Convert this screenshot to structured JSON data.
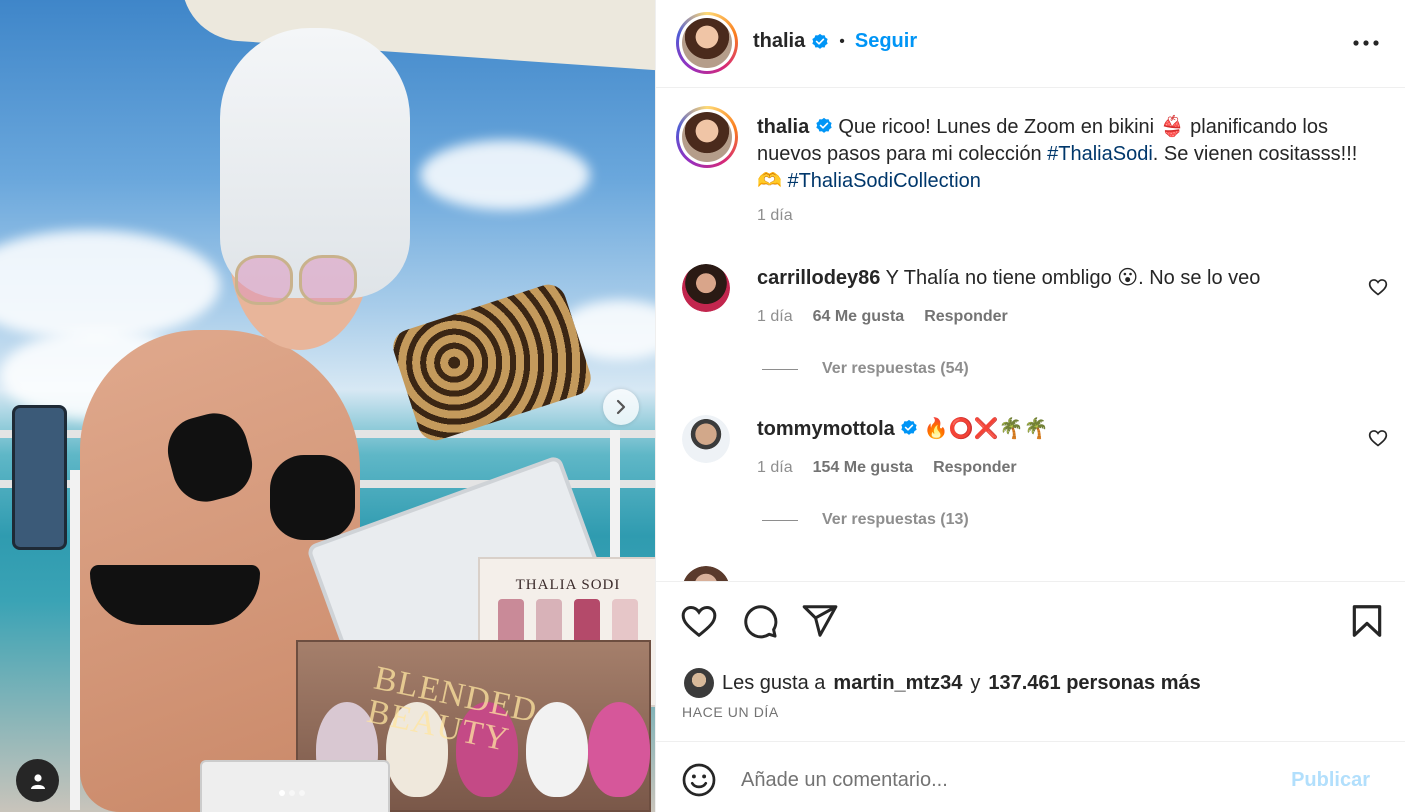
{
  "post": {
    "username": "thalia",
    "follow_label": "Seguir",
    "separator": "•"
  },
  "caption": {
    "username": "thalia",
    "text_part1": "Que ricoo! Lunes de Zoom en bikini 👙 planificando los nuevos pasos para mi colección ",
    "hashtag1": "#ThaliaSodi",
    "text_part2": ". Se vienen cositasss!!! 🫶 ",
    "hashtag2": "#ThaliaSodiCollection",
    "time": "1 día"
  },
  "comments": [
    {
      "username": "carrillodey86",
      "text": "Y Thalía no tiene ombligo 😮. No se lo veo",
      "time": "1 día",
      "likes": "64 Me gusta",
      "reply_label": "Responder",
      "view_replies": "Ver respuestas (54)"
    },
    {
      "username": "tommymottola",
      "text": "🔥⭕❌🌴🌴",
      "time": "1 día",
      "likes": "154 Me gusta",
      "reply_label": "Responder",
      "view_replies": "Ver respuestas (13)"
    }
  ],
  "likes_summary": {
    "prefix": "Les gusta a",
    "user": "martin_mtz34",
    "joiner": "y",
    "rest": "137.461 personas más"
  },
  "post_date": "HACE UN DÍA",
  "comment_input": {
    "placeholder": "Añade un comentario...",
    "post_label": "Publicar"
  },
  "media": {
    "brand_box": "THALIA SODI",
    "product_label": "BLENDED BEAUTY",
    "carousel_index": 1,
    "carousel_total": 3
  },
  "colors": {
    "accent": "#0095f6",
    "hashtag": "#00376b",
    "muted": "#8e8e8e",
    "verified": "#0095f6"
  },
  "icons": [
    "verified-badge-icon",
    "more-options-icon",
    "heart-icon",
    "comment-icon",
    "share-icon",
    "bookmark-icon",
    "emoji-icon",
    "chevron-right-icon",
    "user-tag-icon"
  ]
}
